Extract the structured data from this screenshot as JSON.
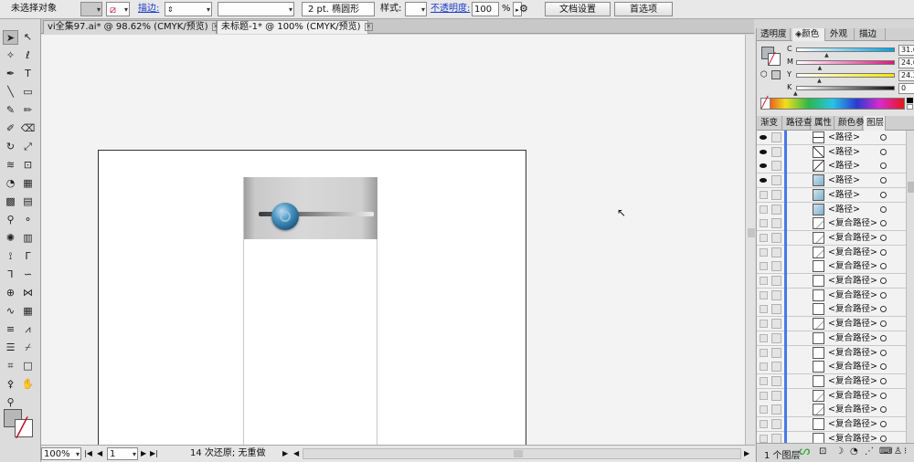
{
  "control_bar": {
    "selection_label": "未选择对象",
    "stroke_label": "描边:",
    "stroke_weight_value": "",
    "brush_label": "2 pt. 椭圆形",
    "style_label": "样式:",
    "opacity_label": "不透明度:",
    "opacity_value": "100",
    "opacity_unit": "%",
    "doc_setup_button": "文档设置",
    "preferences_button": "首选项"
  },
  "tabs": [
    {
      "label": "vi全集97.ai* @ 98.62% (CMYK/预览)",
      "active": false
    },
    {
      "label": "未标题-1* @ 100% (CMYK/预览)",
      "active": true
    }
  ],
  "color_panel": {
    "tabs": [
      "透明度",
      "颜色",
      "外观",
      "描边"
    ],
    "active_tab": "颜色",
    "channels": [
      {
        "letter": "C",
        "value": "31.64",
        "unit": "%",
        "level": 0.3164,
        "gradient": [
          "#ffffff",
          "#00a2e0"
        ]
      },
      {
        "letter": "M",
        "value": "24.61",
        "unit": "%",
        "level": 0.2461,
        "gradient": [
          "#ffffff",
          "#e0157c"
        ]
      },
      {
        "letter": "Y",
        "value": "24.22",
        "unit": "%",
        "level": 0.2422,
        "gradient": [
          "#ffffff",
          "#f2e600"
        ]
      },
      {
        "letter": "K",
        "value": "0",
        "unit": "%",
        "level": 0.0,
        "gradient": [
          "#ffffff",
          "#111111"
        ]
      }
    ],
    "fill_color": "#b5b8bb"
  },
  "layers_panel": {
    "tabs": [
      "渐变",
      "路径查",
      "属性",
      "颜色参",
      "图层"
    ],
    "active_tab": "图层",
    "rows": [
      {
        "name": "<路径>",
        "visible": true,
        "thumb": "hline"
      },
      {
        "name": "<路径>",
        "visible": true,
        "thumb": "diag"
      },
      {
        "name": "<路径>",
        "visible": true,
        "thumb": "diag2"
      },
      {
        "name": "<路径>",
        "visible": true,
        "thumb": "blue"
      },
      {
        "name": "<路径>",
        "visible": false,
        "thumb": "blue"
      },
      {
        "name": "<路径>",
        "visible": false,
        "thumb": "blue"
      },
      {
        "name": "<复合路径>",
        "visible": false,
        "thumb": "mini"
      },
      {
        "name": "<复合路径>",
        "visible": false,
        "thumb": "mini"
      },
      {
        "name": "<复合路径>",
        "visible": false,
        "thumb": "mini"
      },
      {
        "name": "<复合路径>",
        "visible": false,
        "thumb": "blank"
      },
      {
        "name": "<复合路径>",
        "visible": false,
        "thumb": "blank"
      },
      {
        "name": "<复合路径>",
        "visible": false,
        "thumb": "blank"
      },
      {
        "name": "<复合路径>",
        "visible": false,
        "thumb": "blank"
      },
      {
        "name": "<复合路径>",
        "visible": false,
        "thumb": "mini"
      },
      {
        "name": "<复合路径>",
        "visible": false,
        "thumb": "blank"
      },
      {
        "name": "<复合路径>",
        "visible": false,
        "thumb": "blank"
      },
      {
        "name": "<复合路径>",
        "visible": false,
        "thumb": "blank"
      },
      {
        "name": "<复合路径>",
        "visible": false,
        "thumb": "blank"
      },
      {
        "name": "<复合路径>",
        "visible": false,
        "thumb": "mini"
      },
      {
        "name": "<复合路径>",
        "visible": false,
        "thumb": "mini"
      },
      {
        "name": "<复合路径>",
        "visible": false,
        "thumb": "blank"
      },
      {
        "name": "<复合路径>",
        "visible": false,
        "thumb": "blank"
      }
    ],
    "footer_text": "1 个图层"
  },
  "status_bar": {
    "zoom": "100%",
    "artboard_number": "1",
    "undo_text": "14 次还原; 无重做"
  },
  "tools": [
    {
      "name": "selection-tool",
      "glyph": "➤"
    },
    {
      "name": "direct-selection-tool",
      "glyph": "↖"
    },
    {
      "name": "magic-wand-tool",
      "glyph": "✧"
    },
    {
      "name": "lasso-tool",
      "glyph": "ℓ"
    },
    {
      "name": "pen-tool",
      "glyph": "✒"
    },
    {
      "name": "type-tool",
      "glyph": "T"
    },
    {
      "name": "line-tool",
      "glyph": "╲"
    },
    {
      "name": "rectangle-tool",
      "glyph": "▭"
    },
    {
      "name": "paintbrush-tool",
      "glyph": "✎"
    },
    {
      "name": "pencil-tool",
      "glyph": "✏"
    },
    {
      "name": "blob-brush-tool",
      "glyph": "✐"
    },
    {
      "name": "eraser-tool",
      "glyph": "⌫"
    },
    {
      "name": "rotate-tool",
      "glyph": "↻"
    },
    {
      "name": "scale-tool",
      "glyph": "⤢"
    },
    {
      "name": "warp-tool",
      "glyph": "≋"
    },
    {
      "name": "free-transform-tool",
      "glyph": "⊡"
    },
    {
      "name": "shape-builder-tool",
      "glyph": "◔"
    },
    {
      "name": "perspective-grid-tool",
      "glyph": "▦"
    },
    {
      "name": "mesh-tool",
      "glyph": "▩"
    },
    {
      "name": "gradient-tool",
      "glyph": "▤"
    },
    {
      "name": "eyedropper-tool",
      "glyph": "⚲"
    },
    {
      "name": "blend-tool",
      "glyph": "⚬"
    },
    {
      "name": "symbol-sprayer-tool",
      "glyph": "✺"
    },
    {
      "name": "column-graph-tool",
      "glyph": "▥"
    },
    {
      "name": "width-tool",
      "glyph": "⟟"
    },
    {
      "name": "anchor-convert-tool",
      "glyph": "Γ"
    },
    {
      "name": "add-anchor-tool",
      "glyph": "⅂"
    },
    {
      "name": "reshape-tool",
      "glyph": "∽"
    },
    {
      "name": "target-tool",
      "glyph": "⊕"
    },
    {
      "name": "envelope-tool",
      "glyph": "⋈"
    },
    {
      "name": "wave-tool",
      "glyph": "∿"
    },
    {
      "name": "grid-tool",
      "glyph": "▦"
    },
    {
      "name": "chart-tool",
      "glyph": "≡"
    },
    {
      "name": "zigzag-tool",
      "glyph": "⩘"
    },
    {
      "name": "list-tool",
      "glyph": "☰"
    },
    {
      "name": "knife-tool",
      "glyph": "⌿"
    },
    {
      "name": "slice-tool",
      "glyph": "⌗"
    },
    {
      "name": "artboard-tool",
      "glyph": "□"
    },
    {
      "name": "eyedropper-2-tool",
      "glyph": "⚴"
    },
    {
      "name": "hand-tool",
      "glyph": "✋"
    },
    {
      "name": "zoom-tool",
      "glyph": "⚲"
    }
  ]
}
